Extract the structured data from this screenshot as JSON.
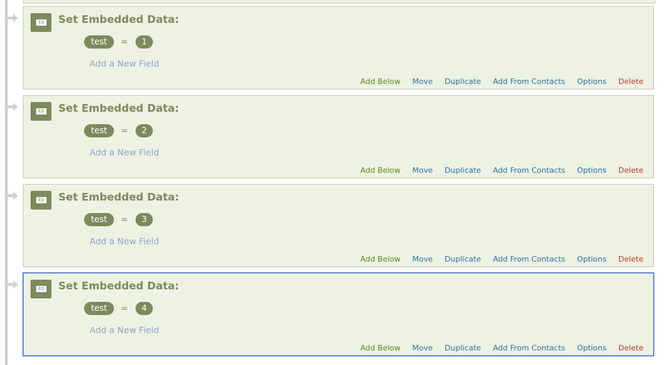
{
  "blocks": [
    {
      "icon_label": "ED",
      "title": "Set Embedded Data:",
      "field_key": "test",
      "equals": "=",
      "field_value": "1",
      "add_field": "Add a New Field",
      "selected": false
    },
    {
      "icon_label": "ED",
      "title": "Set Embedded Data:",
      "field_key": "test",
      "equals": "=",
      "field_value": "2",
      "add_field": "Add a New Field",
      "selected": false
    },
    {
      "icon_label": "ED",
      "title": "Set Embedded Data:",
      "field_key": "test",
      "equals": "=",
      "field_value": "3",
      "add_field": "Add a New Field",
      "selected": false
    },
    {
      "icon_label": "ED",
      "title": "Set Embedded Data:",
      "field_key": "test",
      "equals": "=",
      "field_value": "4",
      "add_field": "Add a New Field",
      "selected": true
    }
  ],
  "actions": {
    "add_below": "Add Below",
    "move": "Move",
    "duplicate": "Duplicate",
    "add_from_contacts": "Add From Contacts",
    "options": "Options",
    "delete": "Delete"
  },
  "colors": {
    "block_bg": "#edf2e2",
    "accent_olive": "#7c8a5c",
    "link_blue": "#2f6fa8",
    "add_below_green": "#5a8a1e",
    "delete_red": "#c0392b",
    "selected_border": "#3b73c7"
  }
}
